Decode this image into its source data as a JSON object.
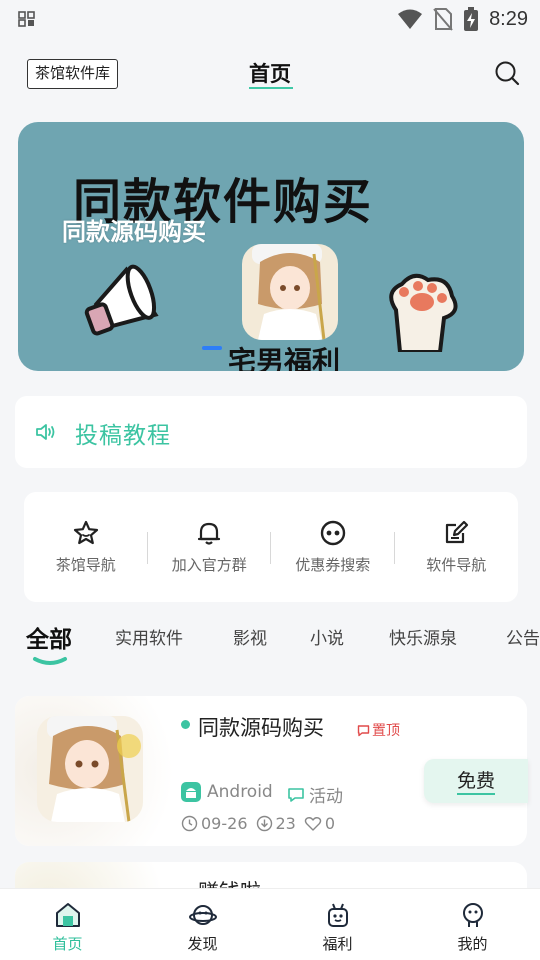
{
  "status_bar": {
    "time": "8:29"
  },
  "header": {
    "library_button": "茶馆软件库",
    "title": "首页"
  },
  "banner": {
    "big_text": "同款软件购买",
    "caption": "同款源码购买",
    "sub_text": "宅男福利"
  },
  "notice": {
    "text": "投稿教程"
  },
  "quick_nav": [
    {
      "label": "茶馆导航",
      "icon": "star-icon"
    },
    {
      "label": "加入官方群",
      "icon": "bell-icon"
    },
    {
      "label": "优惠券搜索",
      "icon": "face-icon"
    },
    {
      "label": "软件导航",
      "icon": "edit-icon"
    }
  ],
  "categories": [
    "全部",
    "实用软件",
    "影视",
    "小说",
    "快乐源泉",
    "公告"
  ],
  "list": [
    {
      "name": "同款源码购买",
      "pin_label": "置顶",
      "platform": "Android",
      "tag": "活动",
      "date": "09-26",
      "downloads": "23",
      "likes": "0",
      "action": "免费"
    },
    {
      "name": "赚钱啦"
    }
  ],
  "bottom_nav": [
    {
      "label": "首页",
      "icon": "home-icon"
    },
    {
      "label": "发现",
      "icon": "planet-icon"
    },
    {
      "label": "福利",
      "icon": "gift-robot-icon"
    },
    {
      "label": "我的",
      "icon": "person-icon"
    }
  ],
  "colors": {
    "accent": "#3cc4a2",
    "banner_bg": "#6fa5b1",
    "pin_red": "#e14a4a"
  }
}
